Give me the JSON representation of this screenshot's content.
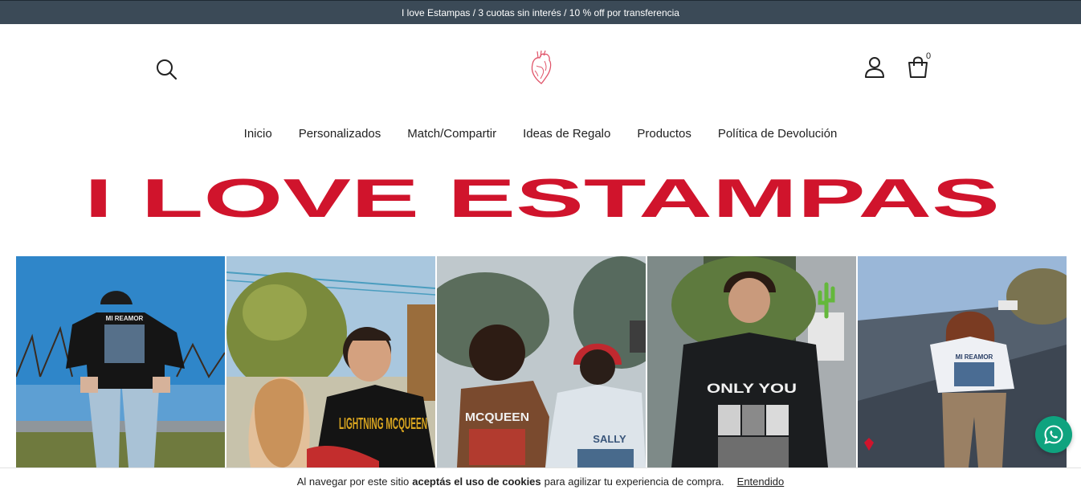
{
  "announcement": "I love Estampas / 3 cuotas sin interés / 10 % off por transferencia",
  "header": {
    "cart_count": "0"
  },
  "nav": {
    "items": [
      "Inicio",
      "Personalizados",
      "Match/Compartir",
      "Ideas de Regalo",
      "Productos",
      "Política de Devolución"
    ]
  },
  "banner": {
    "text": "I LOVE ESTAMPAS"
  },
  "gallery": {
    "shirt_texts": [
      "MI REAMOR",
      "LIGHTNING MCQUEEN",
      "MCQUEEN",
      "SALLY",
      "ONLY YOU",
      "MI REAMOR"
    ]
  },
  "cookie": {
    "before": "Al navegar por este sitio",
    "bold": "aceptás el uso de cookies",
    "after": "para agilizar tu experiencia de compra.",
    "accept_label": "Entendido"
  },
  "colors": {
    "topbar": "#3b4a57",
    "brand_red": "#d0142c",
    "whatsapp": "#0fa37f"
  },
  "icons": [
    "search-icon",
    "heart-logo",
    "user-icon",
    "cart-icon",
    "whatsapp-icon"
  ]
}
